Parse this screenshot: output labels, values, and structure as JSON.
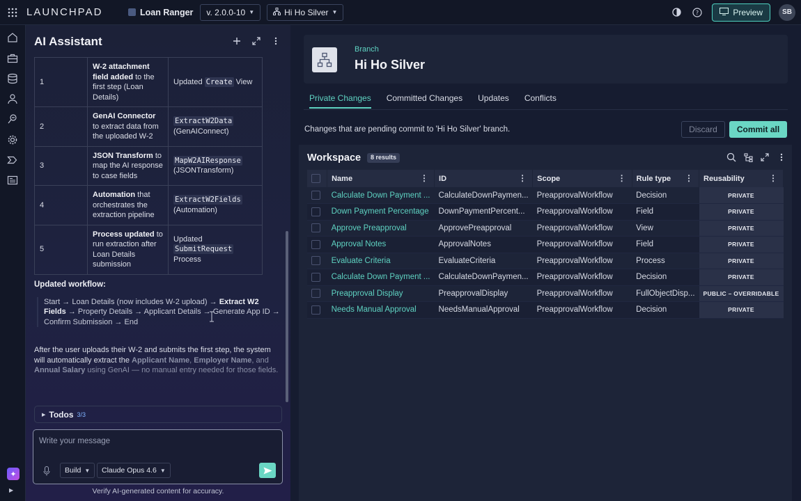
{
  "topbar": {
    "brand": "LAUNCHPAD",
    "app_name": "Loan Ranger",
    "version": "v. 2.0.0-10",
    "branch": "Hi Ho Silver",
    "preview_label": "Preview",
    "avatar_initials": "SB"
  },
  "assistant": {
    "title": "AI Assistant",
    "steps": [
      {
        "num": "1",
        "bold": "W-2 attachment field added",
        "text": " to the first step (Loan Details)",
        "change_pre": "Updated ",
        "change_code": "Create",
        "change_post": " View"
      },
      {
        "num": "2",
        "bold": "GenAI Connector",
        "text": " to extract data from the uploaded W-2",
        "change_pre": "",
        "change_code": "ExtractW2Data",
        "change_post": "(GenAIConnect)"
      },
      {
        "num": "3",
        "bold": "JSON Transform",
        "text": " to map the AI response to case fields",
        "change_pre": "",
        "change_code": "MapW2AIResponse",
        "change_post": "(JSONTransform)"
      },
      {
        "num": "4",
        "bold": "Automation",
        "text": " that orchestrates the extraction pipeline",
        "change_pre": "",
        "change_code": "ExtractW2Fields",
        "change_post": "(Automation)"
      },
      {
        "num": "5",
        "bold": "Process updated",
        "text": " to run extraction after Loan Details submission",
        "change_pre": "Updated ",
        "change_code": "SubmitRequest",
        "change_post": "Process"
      }
    ],
    "updated_heading": "Updated workflow:",
    "workflow_a": "Start → Loan Details (now includes W-2 upload) → ",
    "workflow_bold": "Extract W2 Fields",
    "workflow_b": " → Property Details → Applicant Details → Generate App ID → Confirm Submission → End",
    "after_a": "After the user uploads their W-2 and submits the first step, the system will automatically extract the ",
    "after_f1": "Applicant Name",
    "after_sep1": ", ",
    "after_f2": "Employer Name",
    "after_sep2": ", and ",
    "after_f3": "Annual Salary",
    "after_b": " using GenAI — no manual entry needed for those fields.",
    "todos_label": "Todos",
    "todos_count": "3/3",
    "message_placeholder": "Write your message",
    "mode": "Build",
    "model": "Claude Opus 4.6",
    "disclaimer": "Verify AI-generated content for accuracy."
  },
  "branch": {
    "label": "Branch",
    "name": "Hi Ho Silver",
    "tabs": [
      "Private Changes",
      "Committed Changes",
      "Updates",
      "Conflicts"
    ],
    "pending_text": "Changes that are pending commit to 'Hi Ho Silver' branch.",
    "discard_label": "Discard",
    "commit_label": "Commit all"
  },
  "workspace": {
    "title": "Workspace",
    "badge": "8 results",
    "columns": [
      "Name",
      "ID",
      "Scope",
      "Rule type",
      "Reusability"
    ],
    "rows": [
      [
        "Calculate Down Payment ...",
        "CalculateDownPaymen...",
        "PreapprovalWorkflow",
        "Decision",
        "PRIVATE"
      ],
      [
        "Down Payment Percentage",
        "DownPaymentPercent...",
        "PreapprovalWorkflow",
        "Field",
        "PRIVATE"
      ],
      [
        "Approve Preapproval",
        "ApprovePreapproval",
        "PreapprovalWorkflow",
        "View",
        "PRIVATE"
      ],
      [
        "Approval Notes",
        "ApprovalNotes",
        "PreapprovalWorkflow",
        "Field",
        "PRIVATE"
      ],
      [
        "Evaluate Criteria",
        "EvaluateCriteria",
        "PreapprovalWorkflow",
        "Process",
        "PRIVATE"
      ],
      [
        "Calculate Down Payment ...",
        "CalculateDownPaymen...",
        "PreapprovalWorkflow",
        "Decision",
        "PRIVATE"
      ],
      [
        "Preapproval Display",
        "PreapprovalDisplay",
        "PreapprovalWorkflow",
        "FullObjectDisp...",
        "PUBLIC – OVERRIDABLE"
      ],
      [
        "Needs Manual Approval",
        "NeedsManualApproval",
        "PreapprovalWorkflow",
        "Decision",
        "PRIVATE"
      ]
    ]
  },
  "colors": {
    "accent": "#5fd3c2",
    "primary_button": "#6ad6c4"
  }
}
